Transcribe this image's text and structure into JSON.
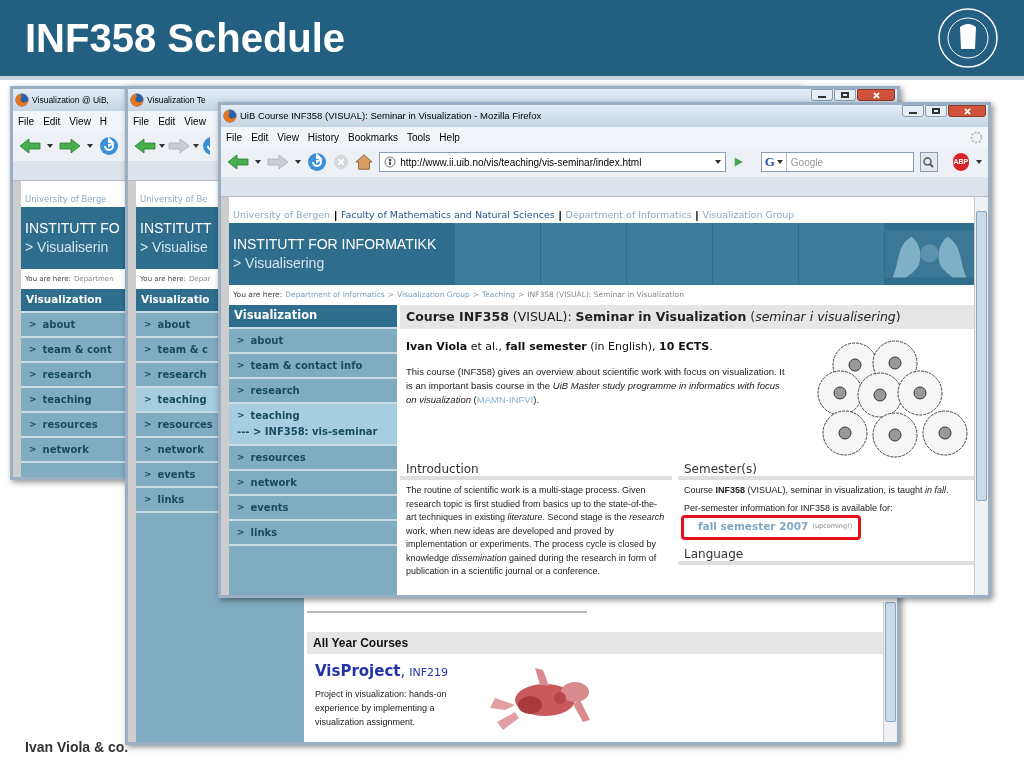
{
  "slide": {
    "title": "INF358 Schedule",
    "footer": "Ivan Viola & co."
  },
  "windows": [
    {
      "title": "Visualization @ UiB,",
      "forward_enabled": true,
      "menu": [
        "File",
        "Edit",
        "View",
        "H"
      ],
      "page": {
        "top_links": [
          {
            "text": "University of Berge",
            "kind": "light"
          }
        ],
        "banner_title": "INSTITUTT FO",
        "banner_sub": "> Visualiserin",
        "here_label": "You are here:",
        "crumbs": [
          "Departmen"
        ],
        "nav_title": "Visualization",
        "nav_marker": ">",
        "nav": [
          {
            "label": "about",
            "selected": false
          },
          {
            "label": "team & cont",
            "selected": false
          },
          {
            "label": "research",
            "selected": false
          },
          {
            "label": "teaching",
            "selected": false
          },
          {
            "label": "resources",
            "selected": false
          },
          {
            "label": "network",
            "selected": false
          }
        ]
      }
    },
    {
      "title": "Visualization Te",
      "controls": true,
      "forward_enabled": false,
      "menu": [
        "File",
        "Edit",
        "View"
      ],
      "page": {
        "top_links": [
          {
            "text": "University of Be",
            "kind": "light"
          }
        ],
        "banner_title": "INSTITUTT",
        "banner_sub": "> Visualise",
        "here_label": "You are here:",
        "crumbs": [
          "Depar"
        ],
        "nav_title": "Visualizatio",
        "nav_marker": ">",
        "nav": [
          {
            "label": "about",
            "selected": false
          },
          {
            "label": "team & c",
            "selected": false
          },
          {
            "label": "research",
            "selected": false
          },
          {
            "label": "teaching",
            "selected": true
          },
          {
            "label": "resources",
            "selected": false
          },
          {
            "label": "network",
            "selected": false
          },
          {
            "label": "events",
            "selected": false
          },
          {
            "label": "links",
            "selected": false
          }
        ],
        "courses": {
          "heading": "All Year Courses",
          "items": [
            {
              "title": "VisProject",
              "sep": ",",
              "code": "INF219",
              "text": "Project in visualization: hands-on experience by implementing a visualization assignment."
            }
          ]
        }
      }
    },
    {
      "title": "UiB Course INF358 (VISUAL): Seminar in Visualization - Mozilla Firefox",
      "controls": true,
      "forward_enabled": false,
      "menu": [
        "File",
        "Edit",
        "View",
        "History",
        "Bookmarks",
        "Tools",
        "Help"
      ],
      "url": "http://www.ii.uib.no/vis/teaching/vis-seminar/index.html",
      "search_placeholder": "Google",
      "search_engine": "G",
      "adblock": "ABP",
      "page": {
        "top_links": [
          {
            "text": "University of Bergen",
            "kind": "light"
          },
          {
            "text": "|",
            "kind": "sep"
          },
          {
            "text": "Faculty of Mathematics and Natural Sciences",
            "kind": "dark"
          },
          {
            "text": "|",
            "kind": "sep"
          },
          {
            "text": "Department of Informatics",
            "kind": "light"
          },
          {
            "text": "|",
            "kind": "sep"
          },
          {
            "text": "Visualization Group",
            "kind": "light"
          }
        ],
        "banner_title": "INSTITUTT FOR INFORMATIKK",
        "banner_sub": "> Visualisering",
        "here_label": "You are here:",
        "crumb_sep": ">",
        "crumbs": [
          "Department of Informatics",
          "Visualization Group",
          "Teaching",
          "INF358 (VISUAL): Seminar in Visualization"
        ],
        "nav_title": "Visualization",
        "nav_marker": ">",
        "nav": [
          {
            "label": "about",
            "selected": false
          },
          {
            "label": "team & contact info",
            "selected": false
          },
          {
            "label": "research",
            "selected": false
          },
          {
            "label": "teaching",
            "selected": true,
            "children": [
              {
                "label": "--- > INF358: vis-seminar",
                "selected": true
              }
            ]
          },
          {
            "label": "resources",
            "selected": false
          },
          {
            "label": "network",
            "selected": false
          },
          {
            "label": "events",
            "selected": false
          },
          {
            "label": "links",
            "selected": false
          }
        ],
        "main": {
          "heading": "**Course INF358** (VISUAL): **Seminar in Visualization** (*seminar i visualisering*)",
          "byline": "**Ivan Viola** et al., **fall semester** (in English), **10 ECTS**.",
          "intro_text": "This course (INF358) gives an overview about scientific work with focus on visualization.  It is an important basis course in the *UiB Master study programme in informatics with focus on visualization* (",
          "intro_link": "MAMN-INFVI",
          "intro_after": ").",
          "intro": {
            "heading": "Introduction",
            "text": "The routine of scientific work is a multi-stage process. Given research topic is first studied from basics up to the state-of-the-art techniques in existing *literature*. Second stage is the *research* work, when new ideas are developed and proved by implementation or experiments. The process cycle is closed by knowledge *dissemination* gained during the research in form of publication in a scientific journal or a conference."
          },
          "semester": {
            "heading": "Semester(s)",
            "text": "Course **INF358** (VISUAL), seminar in visualization, is taught *in fall*.",
            "note": "Per-semester information for INF358 is available for:",
            "link": "fall semester 2007",
            "link_note": "(upcoming!)",
            "highlighted": true
          },
          "language": {
            "heading": "Language"
          }
        }
      }
    }
  ]
}
